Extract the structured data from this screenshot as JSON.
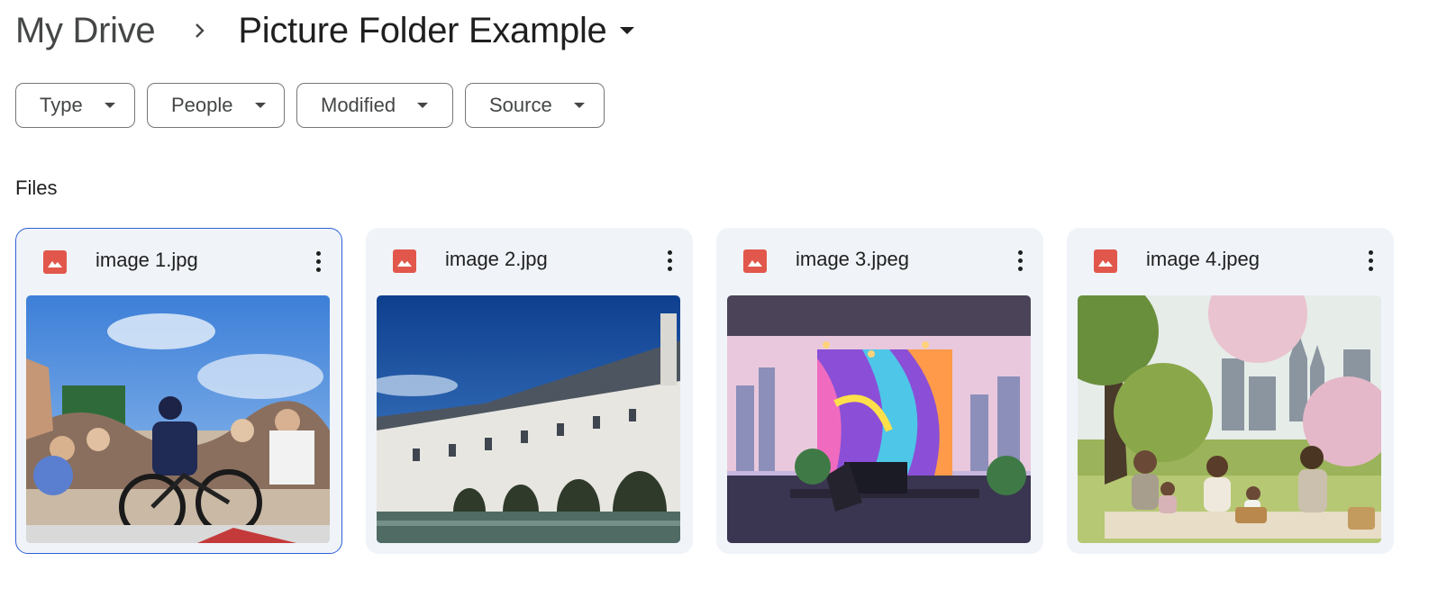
{
  "breadcrumb": {
    "root": "My Drive",
    "current": "Picture Folder Example"
  },
  "filters": [
    {
      "label": "Type"
    },
    {
      "label": "People"
    },
    {
      "label": "Modified"
    },
    {
      "label": "Source"
    }
  ],
  "section_label": "Files",
  "files": [
    {
      "name": "image 1.jpg",
      "selected": true,
      "thumbnail": "cyclist-race-crowd"
    },
    {
      "name": "image 2.jpg",
      "selected": false,
      "thumbnail": "chateau-over-river"
    },
    {
      "name": "image 3.jpeg",
      "selected": false,
      "thumbnail": "office-colorful-mural"
    },
    {
      "name": "image 4.jpeg",
      "selected": false,
      "thumbnail": "park-picnic-family"
    }
  ],
  "colors": {
    "accent": "#2e62d6",
    "image_icon": "#e2574c",
    "card_bg": "#f0f4f9"
  }
}
